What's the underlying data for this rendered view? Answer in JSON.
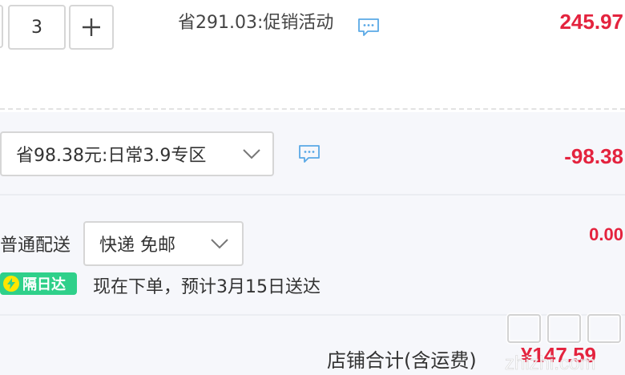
{
  "quantity": {
    "value": "3",
    "increment_symbol": "+"
  },
  "promotion": {
    "text": "省291.03:促销活动",
    "price": "245.97"
  },
  "discount": {
    "selected": "省98.38元:日常3.9专区",
    "amount": "-98.38"
  },
  "shipping": {
    "label": "普通配送",
    "selected": "快递 免邮",
    "fee": "0.00",
    "badge_text": "隔日达",
    "eta_text": "现在下单，预计3月15日送达"
  },
  "total": {
    "label": "店铺合计(含运费)",
    "amount": "¥147.59"
  },
  "watermark": {
    "text": "zhizhi.com"
  },
  "colors": {
    "accent_red": "#e4233e",
    "badge_green": "#2fd08a",
    "icon_blue": "#5aa9e6"
  }
}
